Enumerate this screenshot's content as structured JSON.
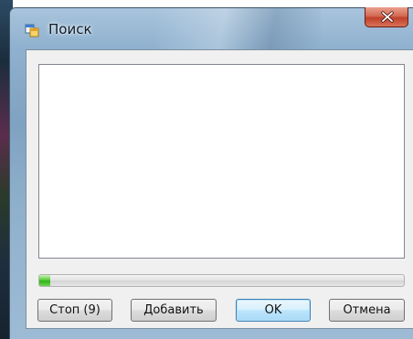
{
  "window": {
    "title": "Поиск"
  },
  "titlebar": {
    "app_icon": "app-window-icon",
    "close_icon": "close-icon"
  },
  "progress": {
    "fraction": 0.03,
    "fill_color": "#3cbf22"
  },
  "buttons": {
    "stop_label": "Стоп (9)",
    "add_label": "Добавить",
    "ok_label": "OK",
    "cancel_label": "Отмена"
  },
  "colors": {
    "close_button": "#c7452f",
    "default_button_border": "#3c7fb1"
  }
}
